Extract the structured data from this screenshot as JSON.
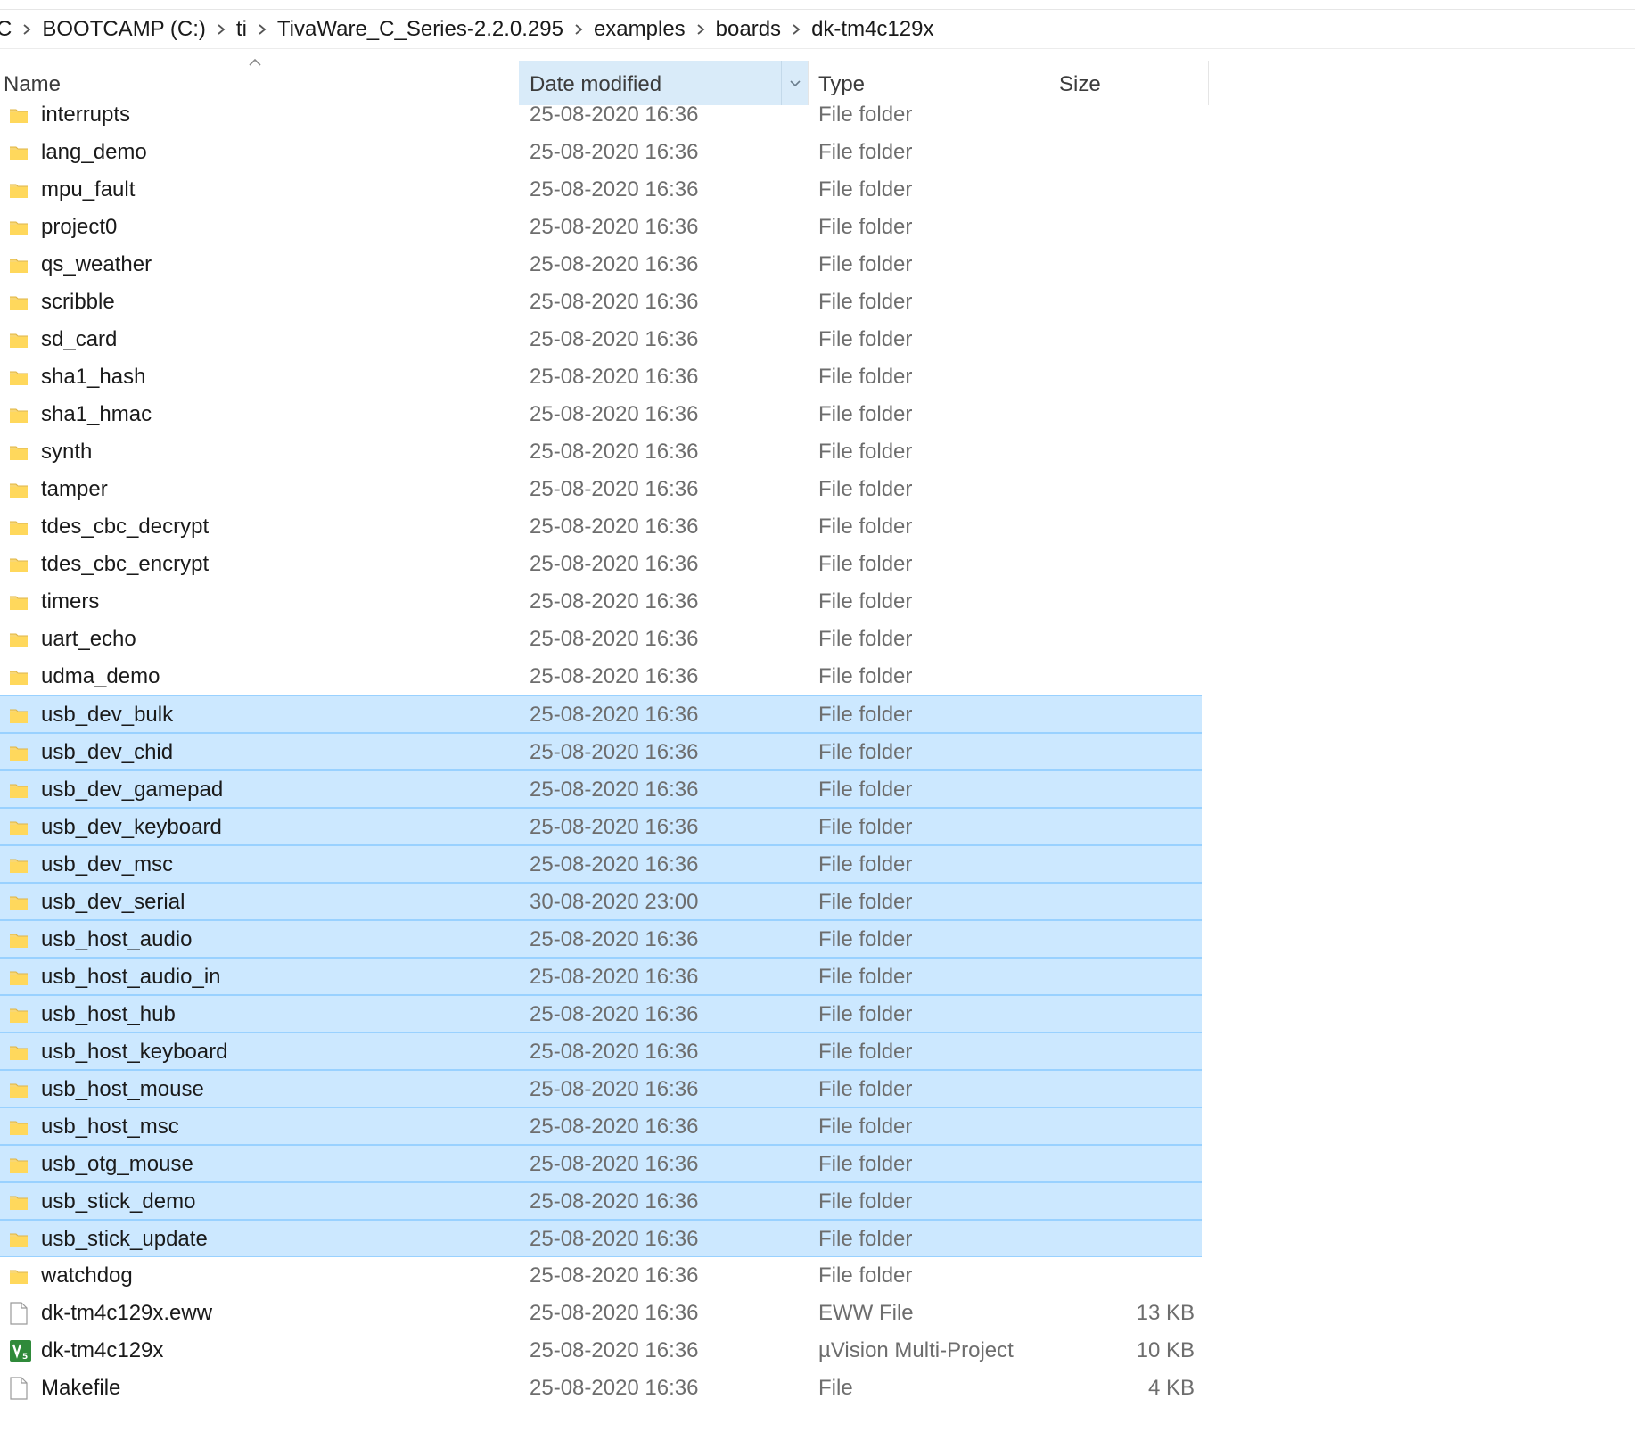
{
  "breadcrumb": {
    "items": [
      "C",
      "BOOTCAMP (C:)",
      "ti",
      "TivaWare_C_Series-2.2.0.295",
      "examples",
      "boards",
      "dk-tm4c129x"
    ]
  },
  "columns": {
    "name": "Name",
    "date": "Date modified",
    "type": "Type",
    "size": "Size",
    "sorted_by": "date"
  },
  "colors": {
    "selection_bg": "#cce8ff",
    "selection_border": "#99d1ff",
    "header_active_bg": "#d9ebf9",
    "folder_yellow": "#f8d775"
  },
  "files": [
    {
      "name": "interrupts",
      "date": "25-08-2020 16:36",
      "type": "File folder",
      "size": "",
      "icon": "folder-icon",
      "selected": false
    },
    {
      "name": "lang_demo",
      "date": "25-08-2020 16:36",
      "type": "File folder",
      "size": "",
      "icon": "folder-icon",
      "selected": false
    },
    {
      "name": "mpu_fault",
      "date": "25-08-2020 16:36",
      "type": "File folder",
      "size": "",
      "icon": "folder-icon",
      "selected": false
    },
    {
      "name": "project0",
      "date": "25-08-2020 16:36",
      "type": "File folder",
      "size": "",
      "icon": "folder-icon",
      "selected": false
    },
    {
      "name": "qs_weather",
      "date": "25-08-2020 16:36",
      "type": "File folder",
      "size": "",
      "icon": "folder-icon",
      "selected": false
    },
    {
      "name": "scribble",
      "date": "25-08-2020 16:36",
      "type": "File folder",
      "size": "",
      "icon": "folder-icon",
      "selected": false
    },
    {
      "name": "sd_card",
      "date": "25-08-2020 16:36",
      "type": "File folder",
      "size": "",
      "icon": "folder-icon",
      "selected": false
    },
    {
      "name": "sha1_hash",
      "date": "25-08-2020 16:36",
      "type": "File folder",
      "size": "",
      "icon": "folder-icon",
      "selected": false
    },
    {
      "name": "sha1_hmac",
      "date": "25-08-2020 16:36",
      "type": "File folder",
      "size": "",
      "icon": "folder-icon",
      "selected": false
    },
    {
      "name": "synth",
      "date": "25-08-2020 16:36",
      "type": "File folder",
      "size": "",
      "icon": "folder-icon",
      "selected": false
    },
    {
      "name": "tamper",
      "date": "25-08-2020 16:36",
      "type": "File folder",
      "size": "",
      "icon": "folder-icon",
      "selected": false
    },
    {
      "name": "tdes_cbc_decrypt",
      "date": "25-08-2020 16:36",
      "type": "File folder",
      "size": "",
      "icon": "folder-icon",
      "selected": false
    },
    {
      "name": "tdes_cbc_encrypt",
      "date": "25-08-2020 16:36",
      "type": "File folder",
      "size": "",
      "icon": "folder-icon",
      "selected": false
    },
    {
      "name": "timers",
      "date": "25-08-2020 16:36",
      "type": "File folder",
      "size": "",
      "icon": "folder-icon",
      "selected": false
    },
    {
      "name": "uart_echo",
      "date": "25-08-2020 16:36",
      "type": "File folder",
      "size": "",
      "icon": "folder-icon",
      "selected": false
    },
    {
      "name": "udma_demo",
      "date": "25-08-2020 16:36",
      "type": "File folder",
      "size": "",
      "icon": "folder-icon",
      "selected": false
    },
    {
      "name": "usb_dev_bulk",
      "date": "25-08-2020 16:36",
      "type": "File folder",
      "size": "",
      "icon": "folder-icon",
      "selected": true
    },
    {
      "name": "usb_dev_chid",
      "date": "25-08-2020 16:36",
      "type": "File folder",
      "size": "",
      "icon": "folder-icon",
      "selected": true
    },
    {
      "name": "usb_dev_gamepad",
      "date": "25-08-2020 16:36",
      "type": "File folder",
      "size": "",
      "icon": "folder-icon",
      "selected": true
    },
    {
      "name": "usb_dev_keyboard",
      "date": "25-08-2020 16:36",
      "type": "File folder",
      "size": "",
      "icon": "folder-icon",
      "selected": true
    },
    {
      "name": "usb_dev_msc",
      "date": "25-08-2020 16:36",
      "type": "File folder",
      "size": "",
      "icon": "folder-icon",
      "selected": true
    },
    {
      "name": "usb_dev_serial",
      "date": "30-08-2020 23:00",
      "type": "File folder",
      "size": "",
      "icon": "folder-icon",
      "selected": true
    },
    {
      "name": "usb_host_audio",
      "date": "25-08-2020 16:36",
      "type": "File folder",
      "size": "",
      "icon": "folder-icon",
      "selected": true
    },
    {
      "name": "usb_host_audio_in",
      "date": "25-08-2020 16:36",
      "type": "File folder",
      "size": "",
      "icon": "folder-icon",
      "selected": true
    },
    {
      "name": "usb_host_hub",
      "date": "25-08-2020 16:36",
      "type": "File folder",
      "size": "",
      "icon": "folder-icon",
      "selected": true
    },
    {
      "name": "usb_host_keyboard",
      "date": "25-08-2020 16:36",
      "type": "File folder",
      "size": "",
      "icon": "folder-icon",
      "selected": true
    },
    {
      "name": "usb_host_mouse",
      "date": "25-08-2020 16:36",
      "type": "File folder",
      "size": "",
      "icon": "folder-icon",
      "selected": true
    },
    {
      "name": "usb_host_msc",
      "date": "25-08-2020 16:36",
      "type": "File folder",
      "size": "",
      "icon": "folder-icon",
      "selected": true
    },
    {
      "name": "usb_otg_mouse",
      "date": "25-08-2020 16:36",
      "type": "File folder",
      "size": "",
      "icon": "folder-icon",
      "selected": true
    },
    {
      "name": "usb_stick_demo",
      "date": "25-08-2020 16:36",
      "type": "File folder",
      "size": "",
      "icon": "folder-icon",
      "selected": true
    },
    {
      "name": "usb_stick_update",
      "date": "25-08-2020 16:36",
      "type": "File folder",
      "size": "",
      "icon": "folder-icon",
      "selected": true
    },
    {
      "name": "watchdog",
      "date": "25-08-2020 16:36",
      "type": "File folder",
      "size": "",
      "icon": "folder-icon",
      "selected": false
    },
    {
      "name": "dk-tm4c129x.eww",
      "date": "25-08-2020 16:36",
      "type": "EWW File",
      "size": "13 KB",
      "icon": "file-icon",
      "selected": false
    },
    {
      "name": "dk-tm4c129x",
      "date": "25-08-2020 16:36",
      "type": "µVision Multi-Project",
      "size": "10 KB",
      "icon": "uvision-project-icon",
      "selected": false
    },
    {
      "name": "Makefile",
      "date": "25-08-2020 16:36",
      "type": "File",
      "size": "4 KB",
      "icon": "file-icon",
      "selected": false
    }
  ]
}
